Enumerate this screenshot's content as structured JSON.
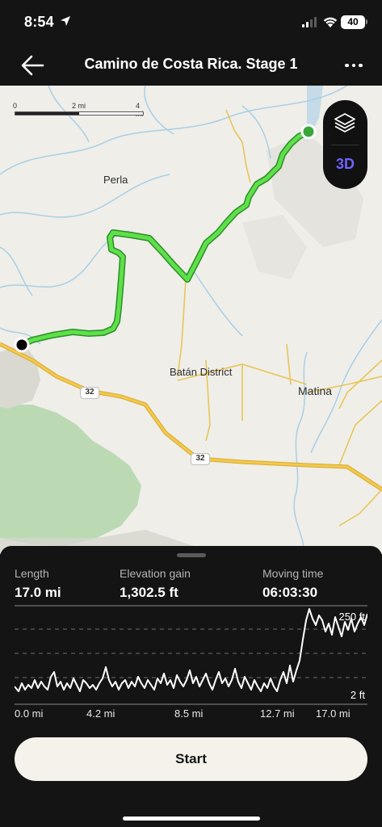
{
  "status": {
    "time": "8:54",
    "battery": "40"
  },
  "nav": {
    "title": "Camino de Costa Rica. Stage 1"
  },
  "map": {
    "scale": {
      "labels": [
        "0",
        "2 mi",
        "4 mi"
      ]
    },
    "places": [
      "Perla",
      "Batán District",
      "Matina"
    ],
    "road_shields": [
      "32",
      "32"
    ],
    "controls": {
      "mode_3d": "3D"
    },
    "route_color": "#52d43c",
    "start_marker_color": "#3aa63a",
    "end_marker_color": "#000000"
  },
  "stats": [
    {
      "label": "Length",
      "value": "17.0 mi"
    },
    {
      "label": "Elevation gain",
      "value": "1,302.5 ft"
    },
    {
      "label": "Moving time",
      "value": "06:03:30"
    }
  ],
  "elevation_chart": {
    "y_max_label": "250 ft",
    "y_min_label": "2 ft",
    "x_labels": [
      "0.0 mi",
      "4.2 mi",
      "8.5 mi",
      "12.7 mi",
      "17.0 mi"
    ]
  },
  "actions": {
    "start_label": "Start"
  }
}
